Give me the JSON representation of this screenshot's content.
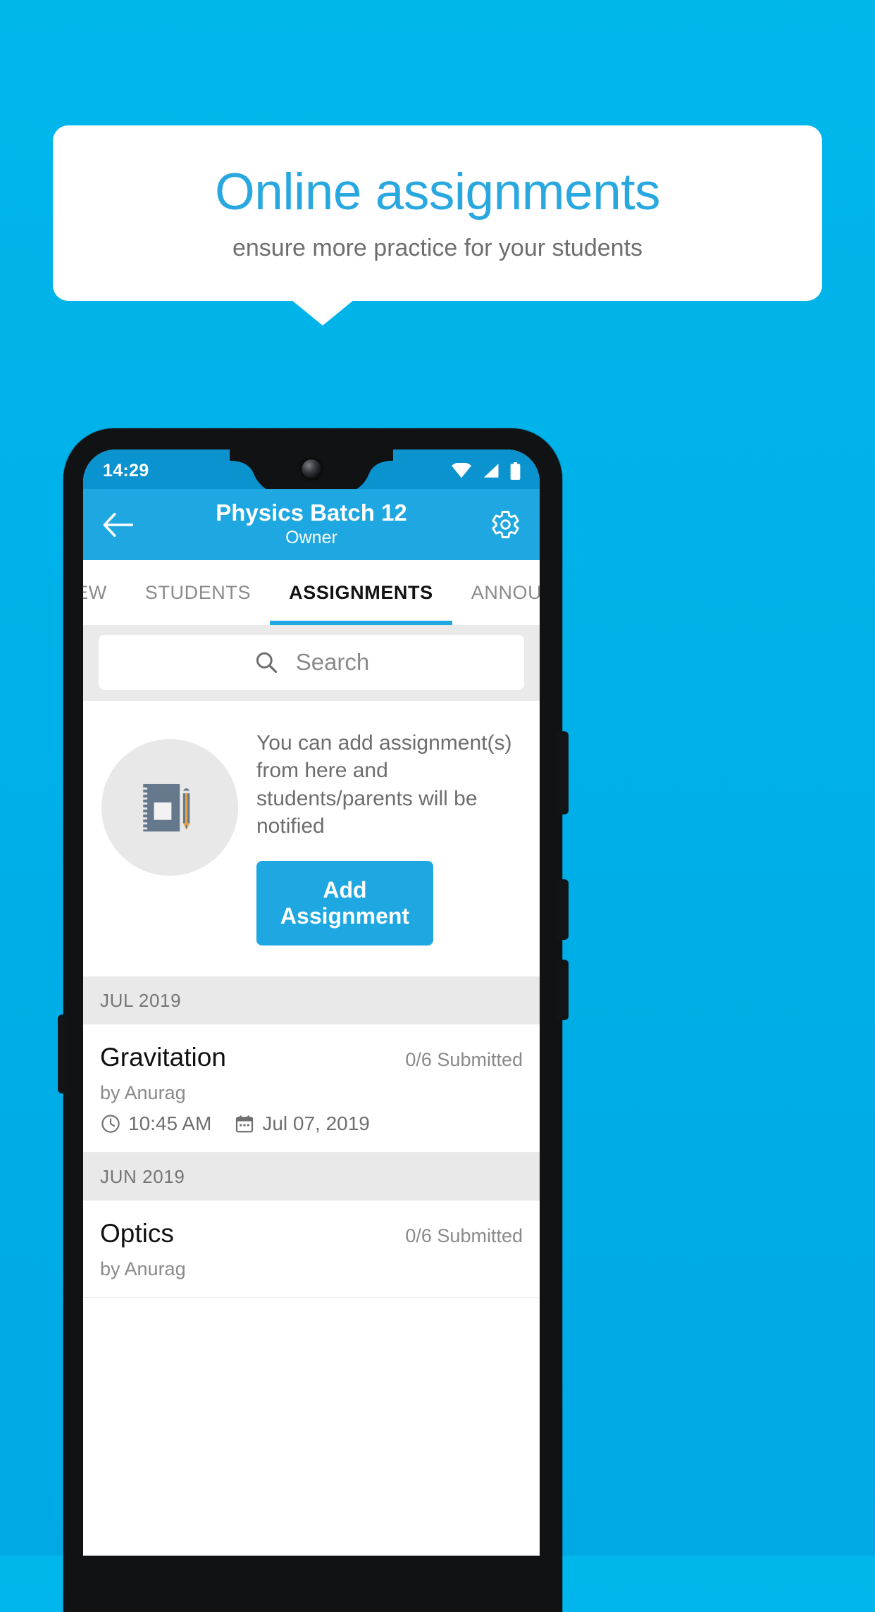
{
  "promo": {
    "title": "Online assignments",
    "subtitle": "ensure more practice for your students",
    "title_color": "#29a8e0",
    "background_color": "#00b0e8"
  },
  "phone": {
    "status_bar": {
      "time": "14:29",
      "icons": [
        "wifi-icon",
        "signal-icon",
        "battery-icon"
      ]
    },
    "app_bar": {
      "back_icon": "back-arrow-icon",
      "title": "Physics Batch 12",
      "subtitle": "Owner",
      "settings_icon": "gear-icon",
      "color": "#1ea7e1"
    },
    "tabs": [
      {
        "label": "IEW",
        "active": false
      },
      {
        "label": "STUDENTS",
        "active": false
      },
      {
        "label": "ASSIGNMENTS",
        "active": true
      },
      {
        "label": "ANNOUNCEM",
        "active": false
      }
    ],
    "search": {
      "placeholder": "Search",
      "icon": "search-icon"
    },
    "empty_state": {
      "illustration": "notebook-and-pen-icon",
      "text": "You can add assignment(s) from here and students/parents will be notified",
      "button_label": "Add Assignment"
    },
    "groups": [
      {
        "month": "JUL 2019",
        "items": [
          {
            "title": "Gravitation",
            "submitted": "0/6 Submitted",
            "author": "by Anurag",
            "time_icon": "clock-icon",
            "time": "10:45 AM",
            "date_icon": "calendar-icon",
            "date": "Jul 07, 2019"
          }
        ]
      },
      {
        "month": "JUN 2019",
        "items": [
          {
            "title": "Optics",
            "submitted": "0/6 Submitted",
            "author": "by Anurag",
            "time_icon": "clock-icon",
            "time": "",
            "date_icon": "calendar-icon",
            "date": ""
          }
        ]
      }
    ]
  }
}
